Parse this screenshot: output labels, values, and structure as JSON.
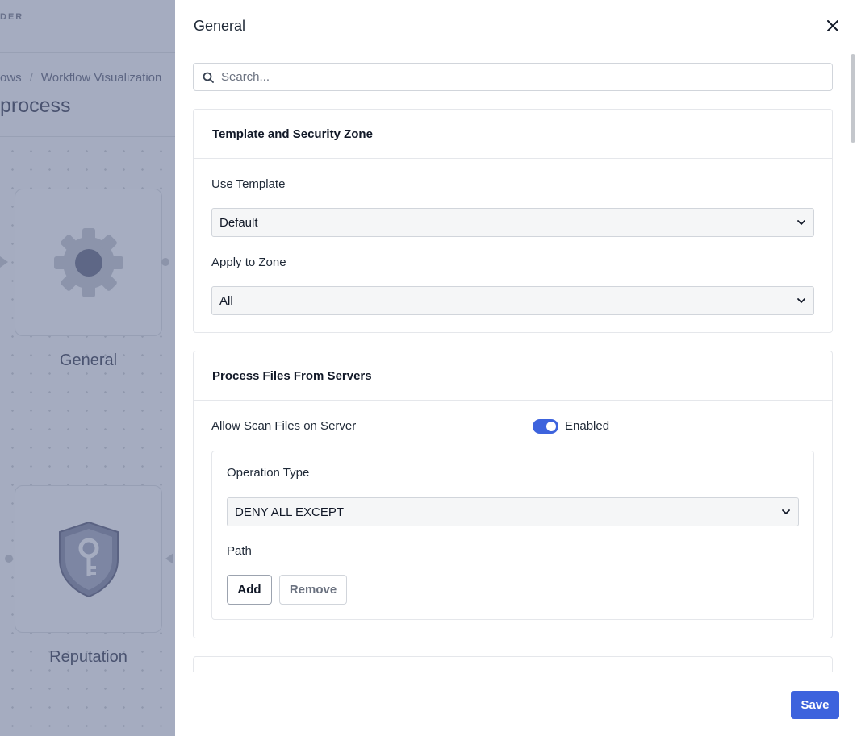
{
  "background": {
    "brand": "DER",
    "breadcrumb": {
      "prev": "ows",
      "separator": "/",
      "current": "Workflow Visualization"
    },
    "page_title": "process",
    "nodes": [
      {
        "label": "General",
        "icon": "gear-icon"
      },
      {
        "label": "Reputation",
        "icon": "shield-key-icon"
      }
    ]
  },
  "panel": {
    "title": "General",
    "close_icon": "close-icon",
    "search": {
      "placeholder": "Search...",
      "value": ""
    },
    "sections": {
      "template": {
        "title": "Template and Security Zone",
        "use_template_label": "Use Template",
        "use_template_value": "Default",
        "apply_zone_label": "Apply to Zone",
        "apply_zone_value": "All"
      },
      "process_files": {
        "title": "Process Files From Servers",
        "allow_scan_label": "Allow Scan Files on Server",
        "allow_scan_state": "Enabled",
        "operation_type_label": "Operation Type",
        "operation_type_value": "DENY ALL EXCEPT",
        "path_label": "Path",
        "add_label": "Add",
        "remove_label": "Remove"
      }
    },
    "save_label": "Save"
  },
  "colors": {
    "accent": "#3d63dd",
    "overlay": "#a5acc0"
  }
}
